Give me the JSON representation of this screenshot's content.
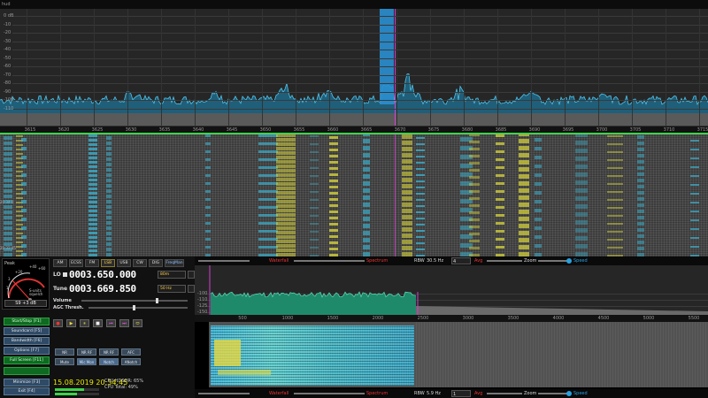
{
  "app": {
    "corner_text": "hud"
  },
  "spectrum": {
    "db_labels": [
      "0 dB",
      "-10",
      "-20",
      "-30",
      "-40",
      "-50",
      "-60",
      "-70",
      "-80",
      "-90",
      "-100",
      "-110"
    ],
    "freq_labels": [
      "3615",
      "3620",
      "3625",
      "3630",
      "3635",
      "3640",
      "3645",
      "3650",
      "3655",
      "3660",
      "3665",
      "3670",
      "3675",
      "3680",
      "3685",
      "3690",
      "3695",
      "3700",
      "3705",
      "3710",
      "3715"
    ]
  },
  "smeter": {
    "peak_label": "Peak",
    "scale_labels": [
      "+40",
      "+20",
      "3",
      "1",
      "+60"
    ],
    "squelch_label": "S-units squelch",
    "readout": "S9 +3 dB"
  },
  "modes": [
    {
      "label": "AM",
      "active": false
    },
    {
      "label": "ECSS",
      "active": false
    },
    {
      "label": "FM",
      "active": false
    },
    {
      "label": "LSB",
      "active": true
    },
    {
      "label": "USB",
      "active": false
    },
    {
      "label": "CW",
      "active": false
    },
    {
      "label": "DIG",
      "active": false
    },
    {
      "label": "FreqMan",
      "active": false
    }
  ],
  "lo": {
    "label": "LO",
    "value": "0003.650.000",
    "unit": "80m"
  },
  "tune": {
    "label": "Tune",
    "value": "0003.669.850",
    "unit": "50 Hz"
  },
  "sliders": {
    "volume": "Volume",
    "agc": "AGC Thresh."
  },
  "transport": [
    "●",
    "▶",
    "⏸",
    "■",
    "⏮",
    "⏭",
    "⬭"
  ],
  "side_buttons": [
    {
      "label": "Start/Stop [F1]",
      "green": true
    },
    {
      "label": "Soundcard [F5]",
      "green": false
    },
    {
      "label": "Bandwidth [F6]",
      "green": false
    },
    {
      "label": "Options [F7]",
      "green": false
    },
    {
      "label": "Full Screen [F11]",
      "green": true
    },
    {
      "label": "",
      "green": true
    },
    {
      "label": "Minimize [F3]",
      "green": false
    },
    {
      "label": "Exit [F4]",
      "green": false
    }
  ],
  "dsp": [
    {
      "label": "NR",
      "on": false
    },
    {
      "label": "NR RF",
      "on": false
    },
    {
      "label": "NR RF",
      "on": false
    },
    {
      "label": "AFC",
      "on": false
    },
    {
      "label": "Mute",
      "on": false
    },
    {
      "label": "Mic Mon",
      "on": true
    },
    {
      "label": "Notch",
      "on": true
    },
    {
      "label": "ANotch",
      "on": false
    }
  ],
  "status": {
    "datetime": "15.08.2019 20:34:45",
    "cpu_sdr_label": "CPU HDSDR: 65%",
    "cpu_total_label": "CPU Total: 49%",
    "cpu_sdr": 0.65,
    "cpu_total": 0.49
  },
  "zoom_top_bar": {
    "waterfall": "Waterfall",
    "spectrum": "Spectrum",
    "rbw_label": "RBW",
    "rbw_value": "30.5 Hz",
    "rbw_box": "4",
    "avg": "Avg",
    "zoom": "Zoom",
    "speed": "Speed"
  },
  "zoom_bottom_bar": {
    "waterfall": "Waterfall",
    "spectrum": "Spectrum",
    "rbw_label": "RBW",
    "rbw_value": "5.9 Hz",
    "rbw_box": "1",
    "avg": "Avg",
    "zoom": "Zoom",
    "speed": "Speed"
  },
  "zoom_spectrum": {
    "db_labels": [
      "-100",
      "-110",
      "-125",
      "-150"
    ],
    "axis_labels": [
      "500",
      "1000",
      "1500",
      "2000",
      "2500",
      "3000",
      "3500",
      "4000",
      "4500",
      "5000",
      "5500"
    ]
  },
  "colors": {
    "accent_green": "#3ed24a",
    "vfo_magenta": "#d23fd0",
    "lsb_yellow": "#ffd04d",
    "spectrum_blue": "#2a8fd0"
  }
}
